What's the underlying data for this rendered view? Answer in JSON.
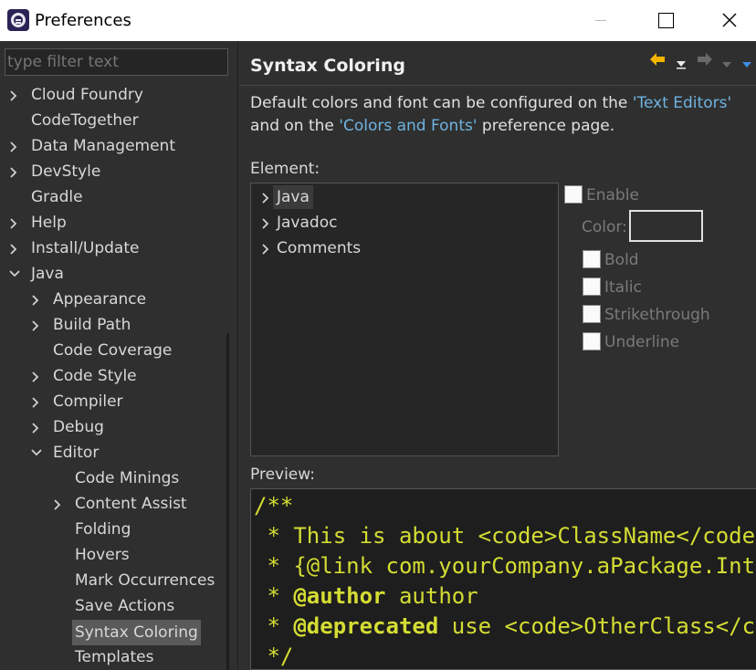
{
  "window": {
    "title": "Preferences"
  },
  "filter": {
    "placeholder": "type filter text"
  },
  "tree": {
    "items": [
      {
        "label": "Cloud Foundry",
        "expander": "collapsed"
      },
      {
        "label": "CodeTogether",
        "expander": "none"
      },
      {
        "label": "Data Management",
        "expander": "collapsed"
      },
      {
        "label": "DevStyle",
        "expander": "collapsed"
      },
      {
        "label": "Gradle",
        "expander": "none"
      },
      {
        "label": "Help",
        "expander": "collapsed"
      },
      {
        "label": "Install/Update",
        "expander": "collapsed"
      },
      {
        "label": "Java",
        "expander": "expanded"
      },
      {
        "label": "Appearance",
        "expander": "collapsed"
      },
      {
        "label": "Build Path",
        "expander": "collapsed"
      },
      {
        "label": "Code Coverage",
        "expander": "none"
      },
      {
        "label": "Code Style",
        "expander": "collapsed"
      },
      {
        "label": "Compiler",
        "expander": "collapsed"
      },
      {
        "label": "Debug",
        "expander": "collapsed"
      },
      {
        "label": "Editor",
        "expander": "expanded"
      },
      {
        "label": "Code Minings",
        "expander": "none"
      },
      {
        "label": "Content Assist",
        "expander": "collapsed"
      },
      {
        "label": "Folding",
        "expander": "none"
      },
      {
        "label": "Hovers",
        "expander": "none"
      },
      {
        "label": "Mark Occurrences",
        "expander": "none"
      },
      {
        "label": "Save Actions",
        "expander": "none"
      },
      {
        "label": "Syntax Coloring",
        "expander": "none",
        "selected": true
      },
      {
        "label": "Templates",
        "expander": "none"
      }
    ]
  },
  "page": {
    "title": "Syntax Coloring",
    "description": {
      "part1": "Default colors and font can be configured on the ",
      "link1": "'Text Editors'",
      "part2": " and on the ",
      "link2": "'Colors and Fonts'",
      "part3": " preference page."
    },
    "element_label": "Element:",
    "elements": [
      "Java",
      "Javadoc",
      "Comments"
    ],
    "options": {
      "enable": "Enable",
      "color": "Color:",
      "bold": "Bold",
      "italic": "Italic",
      "strikethrough": "Strikethrough",
      "underline": "Underline"
    },
    "preview_label": "Preview:",
    "preview_lines": [
      {
        "plain": "/**"
      },
      {
        "plain": " * This is about <code>ClassName</code>"
      },
      {
        "plain": " * {@link com.yourCompany.aPackage.Interface}"
      },
      {
        "prefix": " * ",
        "tag": "@author",
        "rest": " author"
      },
      {
        "prefix": " * ",
        "tag": "@deprecated",
        "rest": " use <code>OtherClass</code>"
      },
      {
        "plain": " */"
      }
    ]
  },
  "colors": {
    "background": "#2f2f2f",
    "link": "#6fb3e0",
    "javadoc": "#d4dd33",
    "back_arrow": "#f5b400",
    "view_menu": "#3c8ce6"
  },
  "icons": [
    "back-arrow-icon",
    "history-dropdown-icon",
    "forward-arrow-icon",
    "view-menu-icon"
  ]
}
